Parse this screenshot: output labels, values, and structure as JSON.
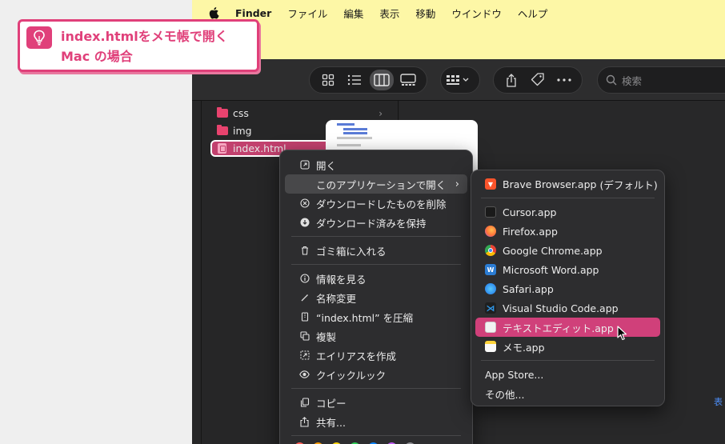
{
  "menubar": {
    "app_name": "Finder",
    "items": [
      "ファイル",
      "編集",
      "表示",
      "移動",
      "ウインドウ",
      "ヘルプ"
    ]
  },
  "callout": {
    "line1": "index.htmlをメモ帳で開く",
    "line2": "Mac の場合",
    "icon": "lightbulb-icon",
    "accent": "#e0407a"
  },
  "toolbar": {
    "search_placeholder": "検索",
    "view_buttons": [
      "icon-view",
      "list-view",
      "column-view",
      "gallery-view"
    ],
    "active_view": "column-view"
  },
  "files": [
    {
      "name": "css",
      "type": "folder"
    },
    {
      "name": "img",
      "type": "folder"
    },
    {
      "name": "index.html",
      "type": "file",
      "selected": true
    }
  ],
  "context_menu": {
    "open": "開く",
    "open_with": "このアプリケーションで開く",
    "delete_download": "ダウンロードしたものを削除",
    "keep_download": "ダウンロード済みを保持",
    "trash": "ゴミ箱に入れる",
    "get_info": "情報を見る",
    "rename": "名称変更",
    "compress": "“index.html” を圧縮",
    "duplicate": "複製",
    "make_alias": "エイリアスを作成",
    "quick_look": "クイックルック",
    "copy": "コピー",
    "share": "共有..."
  },
  "open_with_menu": {
    "default_app": "Brave Browser.app",
    "default_suffix": "(デフォルト)",
    "apps": [
      "Cursor.app",
      "Firefox.app",
      "Google Chrome.app",
      "Microsoft Word.app",
      "Safari.app",
      "Visual Studio Code.app",
      "テキストエディット.app",
      "メモ.app"
    ],
    "highlighted": "テキストエディット.app",
    "app_store": "App Store...",
    "other": "その他..."
  },
  "colors": {
    "highlight": "#d0407a",
    "folder": "#e8436e",
    "menubar_bg": "#fdf7a6"
  }
}
